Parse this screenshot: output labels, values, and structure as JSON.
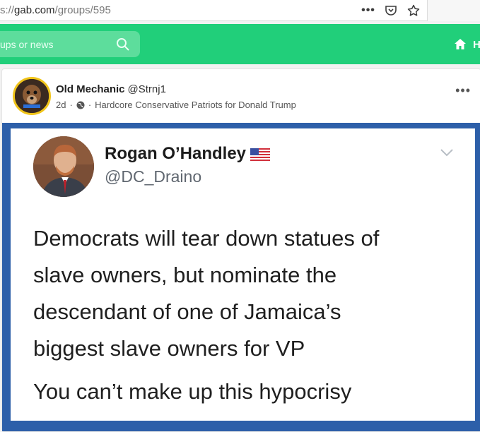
{
  "browser": {
    "url_prefix": "s://",
    "url_domain": "gab.com",
    "url_path": "/groups/595",
    "icons": [
      "more-icon",
      "pocket-icon",
      "star-icon"
    ]
  },
  "header": {
    "search_placeholder": "ups or news",
    "home_label": "H"
  },
  "post": {
    "author_name": "Old Mechanic",
    "author_handle": "@Strnj1",
    "time": "2d",
    "separator": "·",
    "group": "Hardcore Conservative Patriots for Donald Trump",
    "more": "•••"
  },
  "tweet": {
    "name": "Rogan O’Handley",
    "handle": "@DC_Draino",
    "body_lines": [
      "Democrats will tear down statues of",
      "slave owners, but nominate the",
      "descendant of one of Jamaica’s",
      "biggest slave owners for VP"
    ],
    "body_last": "You can’t make up this hypocrisy"
  },
  "colors": {
    "gab_green": "#21cf7a",
    "media_border": "#2d5fa9",
    "avatar_ring": "#f0c419"
  }
}
